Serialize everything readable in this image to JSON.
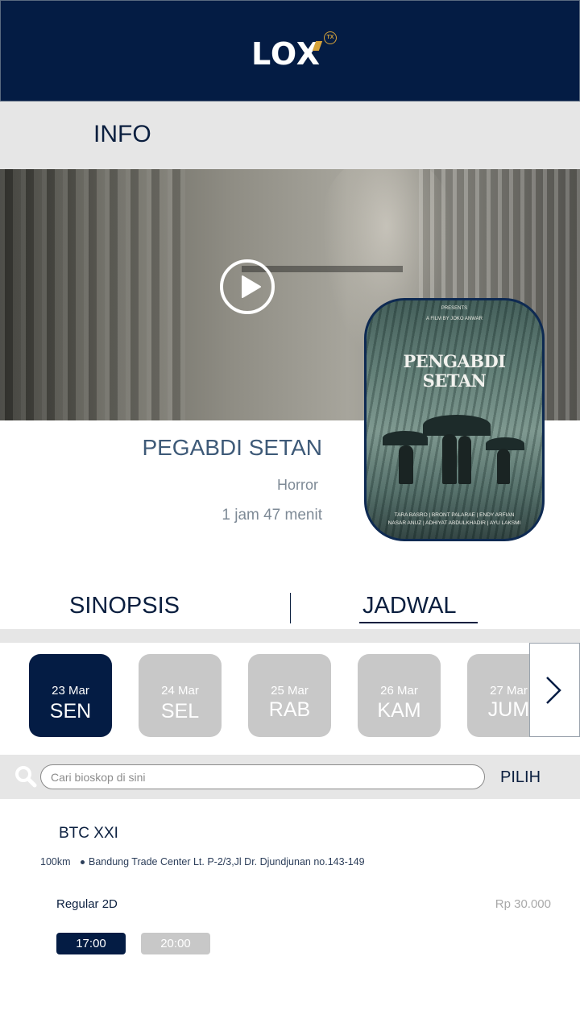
{
  "header": {
    "logo_text": "LOX",
    "logo_badge": "TX"
  },
  "info": {
    "title": "INFO"
  },
  "trailer": {
    "play_icon": "play-icon"
  },
  "poster": {
    "title_line1": "PENGABDI",
    "title_line2": "SETAN",
    "presents": "PRESENTS",
    "film_by": "A FILM BY JOKO ANWAR",
    "cast_line1": "TARA BASRO | BRONT PALARAE | ENDY ARFIAN",
    "cast_line2": "NASAR ANUZ | ADHIYAT ABDULKHADIR | AYU LAKSMI"
  },
  "movie": {
    "title": "PEGABDI SETAN",
    "genre": "Horror",
    "duration": "1 jam 47 menit"
  },
  "tabs": {
    "sinopsis": "SINOPSIS",
    "jadwal": "JADWAL",
    "active": "JADWAL"
  },
  "days": [
    {
      "date": "23 Mar",
      "name": "SEN",
      "active": true
    },
    {
      "date": "24 Mar",
      "name": "SEL",
      "active": false
    },
    {
      "date": "25 Mar",
      "name": "RAB",
      "active": false
    },
    {
      "date": "26 Mar",
      "name": "KAM",
      "active": false
    },
    {
      "date": "27 Mar",
      "name": "JUM",
      "active": false
    }
  ],
  "search": {
    "placeholder": "Cari bioskop di sini",
    "button": "PILIH"
  },
  "cinema": {
    "name": "BTC XXI",
    "distance": "100km",
    "address": "Bandung Trade Center Lt. P-2/3,Jl Dr. Djundjunan no.143-149",
    "format": "Regular 2D",
    "price": "Rp 30.000",
    "times": [
      {
        "label": "17:00",
        "active": true
      },
      {
        "label": "20:00",
        "active": false
      }
    ]
  },
  "colors": {
    "navy": "#041c44",
    "gray_bg": "#e6e6e6",
    "inactive": "#c8c8c8"
  }
}
